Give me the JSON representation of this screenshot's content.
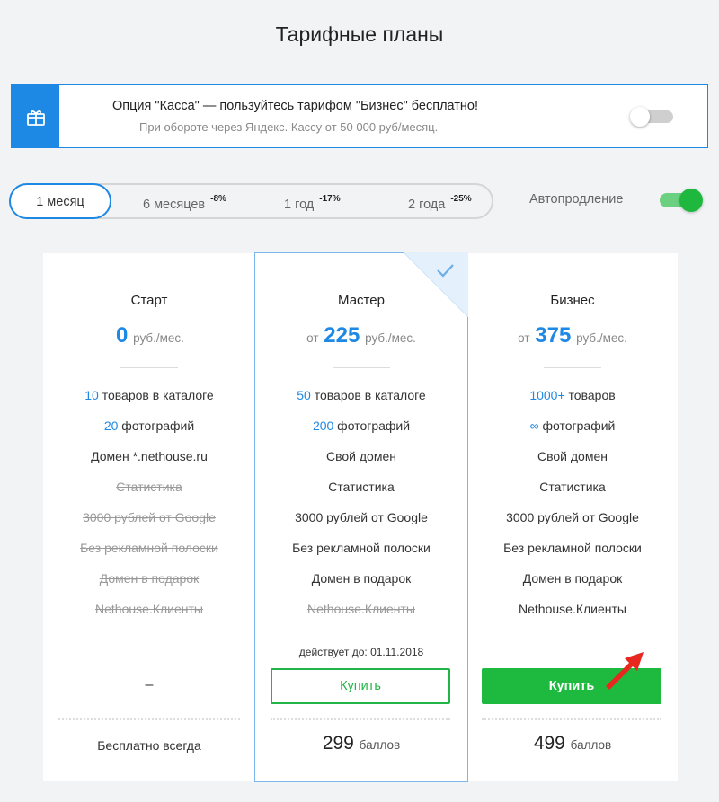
{
  "page_title": "Тарифные планы",
  "promo": {
    "title": "Опция \"Касса\" — пользуйтесь тарифом \"Бизнес\" бесплатно!",
    "subtitle": "При обороте через Яндекс. Кассу от 50 000 руб/месяц.",
    "icon": "gift-icon",
    "toggle_on": false
  },
  "periods": [
    {
      "label": "1 месяц",
      "discount": "",
      "active": true
    },
    {
      "label": "6 месяцев",
      "discount": "-8%",
      "active": false
    },
    {
      "label": "1 год",
      "discount": "-17%",
      "active": false
    },
    {
      "label": "2 года",
      "discount": "-25%",
      "active": false
    }
  ],
  "autorenew": {
    "label": "Автопродление",
    "on": true
  },
  "plans": {
    "start": {
      "name": "Старт",
      "price_prefix": "",
      "price": "0",
      "price_unit": "руб./мес.",
      "features": [
        {
          "hl": "10",
          "text": " товаров в каталоге",
          "struck": false
        },
        {
          "hl": "20",
          "text": " фотографий",
          "struck": false
        },
        {
          "hl": "",
          "text": "Домен *.nethouse.ru",
          "struck": false
        },
        {
          "hl": "",
          "text": "Статистика",
          "struck": true
        },
        {
          "hl": "",
          "text": "3000 рублей от Google",
          "struck": true
        },
        {
          "hl": "",
          "text": "Без рекламной полоски",
          "struck": true
        },
        {
          "hl": "",
          "text": "Домен в подарок",
          "struck": true
        },
        {
          "hl": "",
          "text": "Nethouse.Клиенты",
          "struck": true
        }
      ],
      "action": "–",
      "footer": "Бесплатно всегда"
    },
    "master": {
      "name": "Мастер",
      "price_prefix": "от",
      "price": "225",
      "price_unit": "руб./мес.",
      "features": [
        {
          "hl": "50",
          "text": " товаров в каталоге",
          "struck": false
        },
        {
          "hl": "200",
          "text": " фотографий",
          "struck": false
        },
        {
          "hl": "",
          "text": "Свой домен",
          "struck": false
        },
        {
          "hl": "",
          "text": "Статистика",
          "struck": false
        },
        {
          "hl": "",
          "text": "3000 рублей от Google",
          "struck": false
        },
        {
          "hl": "",
          "text": "Без рекламной полоски",
          "struck": false
        },
        {
          "hl": "",
          "text": "Домен в подарок",
          "struck": false
        },
        {
          "hl": "",
          "text": "Nethouse.Клиенты",
          "struck": true
        }
      ],
      "valid_until": "действует до: 01.11.2018",
      "buy_label": "Купить",
      "points": "299",
      "points_unit": "баллов",
      "selected": true
    },
    "biz": {
      "name": "Бизнес",
      "price_prefix": "от",
      "price": "375",
      "price_unit": "руб./мес.",
      "features": [
        {
          "hl": "1000+",
          "text": " товаров",
          "struck": false
        },
        {
          "hl": "∞",
          "text": " фотографий",
          "struck": false
        },
        {
          "hl": "",
          "text": "Свой домен",
          "struck": false
        },
        {
          "hl": "",
          "text": "Статистика",
          "struck": false
        },
        {
          "hl": "",
          "text": "3000 рублей от Google",
          "struck": false
        },
        {
          "hl": "",
          "text": "Без рекламной полоски",
          "struck": false
        },
        {
          "hl": "",
          "text": "Домен в подарок",
          "struck": false
        },
        {
          "hl": "",
          "text": "Nethouse.Клиенты",
          "struck": false
        }
      ],
      "buy_label": "Купить",
      "points": "499",
      "points_unit": "баллов"
    }
  },
  "colors": {
    "accent": "#1e88e5",
    "buy": "#1dba3f",
    "arrow": "#e8281e"
  }
}
